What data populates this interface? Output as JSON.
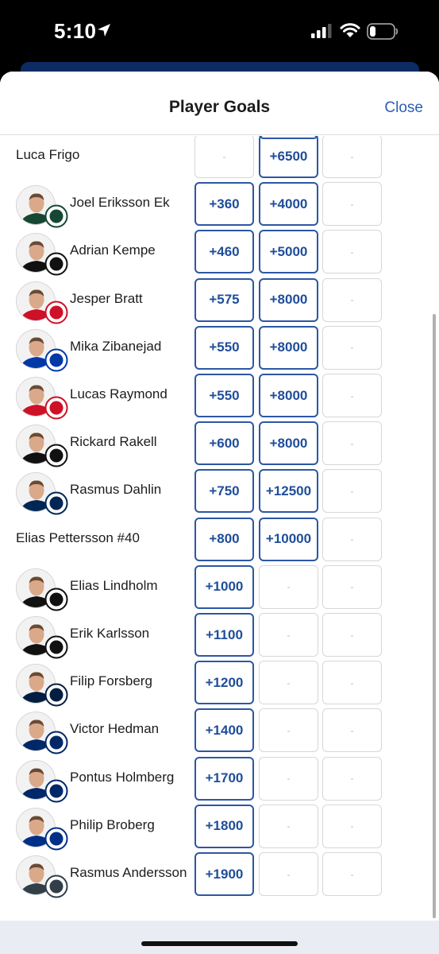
{
  "status_bar": {
    "time": "5:10"
  },
  "sheet": {
    "title": "Player Goals",
    "close_label": "Close"
  },
  "players": [
    {
      "name": "Luca Frigo",
      "has_avatar": false,
      "team_logo": "",
      "odds": [
        "-",
        "+6500",
        "-"
      ]
    },
    {
      "name": "Joel Eriksson Ek",
      "has_avatar": true,
      "team_logo": "minnesota-wild-logo",
      "team_color": "#154734",
      "odds": [
        "+360",
        "+4000",
        "-"
      ]
    },
    {
      "name": "Adrian Kempe",
      "has_avatar": true,
      "team_logo": "la-kings-logo",
      "team_color": "#111111",
      "odds": [
        "+460",
        "+5000",
        "-"
      ]
    },
    {
      "name": "Jesper Bratt",
      "has_avatar": true,
      "team_logo": "nj-devils-logo",
      "team_color": "#ce1126",
      "odds": [
        "+575",
        "+8000",
        "-"
      ]
    },
    {
      "name": "Mika Zibanejad",
      "has_avatar": true,
      "team_logo": "ny-rangers-logo",
      "team_color": "#0038a8",
      "odds": [
        "+550",
        "+8000",
        "-"
      ]
    },
    {
      "name": "Lucas Raymond",
      "has_avatar": true,
      "team_logo": "detroit-red-wings-logo",
      "team_color": "#ce1126",
      "odds": [
        "+550",
        "+8000",
        "-"
      ]
    },
    {
      "name": "Rickard Rakell",
      "has_avatar": true,
      "team_logo": "pittsburgh-penguins-logo",
      "team_color": "#111111",
      "odds": [
        "+600",
        "+8000",
        "-"
      ]
    },
    {
      "name": "Rasmus Dahlin",
      "has_avatar": true,
      "team_logo": "buffalo-sabres-logo",
      "team_color": "#002654",
      "odds": [
        "+750",
        "+12500",
        "-"
      ]
    },
    {
      "name": "Elias Pettersson #40",
      "has_avatar": false,
      "team_logo": "",
      "odds": [
        "+800",
        "+10000",
        "-"
      ]
    },
    {
      "name": "Elias Lindholm",
      "has_avatar": true,
      "team_logo": "boston-bruins-logo",
      "team_color": "#111111",
      "odds": [
        "+1000",
        "-",
        "-"
      ]
    },
    {
      "name": "Erik Karlsson",
      "has_avatar": true,
      "team_logo": "pittsburgh-penguins-logo",
      "team_color": "#111111",
      "odds": [
        "+1100",
        "-",
        "-"
      ]
    },
    {
      "name": "Filip Forsberg",
      "has_avatar": true,
      "team_logo": "nashville-predators-logo",
      "team_color": "#041e42",
      "odds": [
        "+1200",
        "-",
        "-"
      ]
    },
    {
      "name": "Victor Hedman",
      "has_avatar": true,
      "team_logo": "tampa-bay-lightning-logo",
      "team_color": "#002868",
      "odds": [
        "+1400",
        "-",
        "-"
      ]
    },
    {
      "name": "Pontus Holmberg",
      "has_avatar": true,
      "team_logo": "tampa-bay-lightning-logo",
      "team_color": "#002868",
      "odds": [
        "+1700",
        "-",
        "-"
      ]
    },
    {
      "name": "Philip Broberg",
      "has_avatar": true,
      "team_logo": "st-louis-blues-logo",
      "team_color": "#002f87",
      "odds": [
        "+1800",
        "-",
        "-"
      ]
    },
    {
      "name": "Rasmus Andersson",
      "has_avatar": true,
      "team_logo": "vegas-golden-knights-logo",
      "team_color": "#333f48",
      "odds": [
        "+1900",
        "-",
        "-"
      ]
    }
  ],
  "colors": {
    "accent": "#2b5fb3",
    "odds_text": "#1f4d99",
    "odds_border": "#2c57a4",
    "empty_border": "#d7d7d7",
    "header_strip": "#0c2c63"
  }
}
